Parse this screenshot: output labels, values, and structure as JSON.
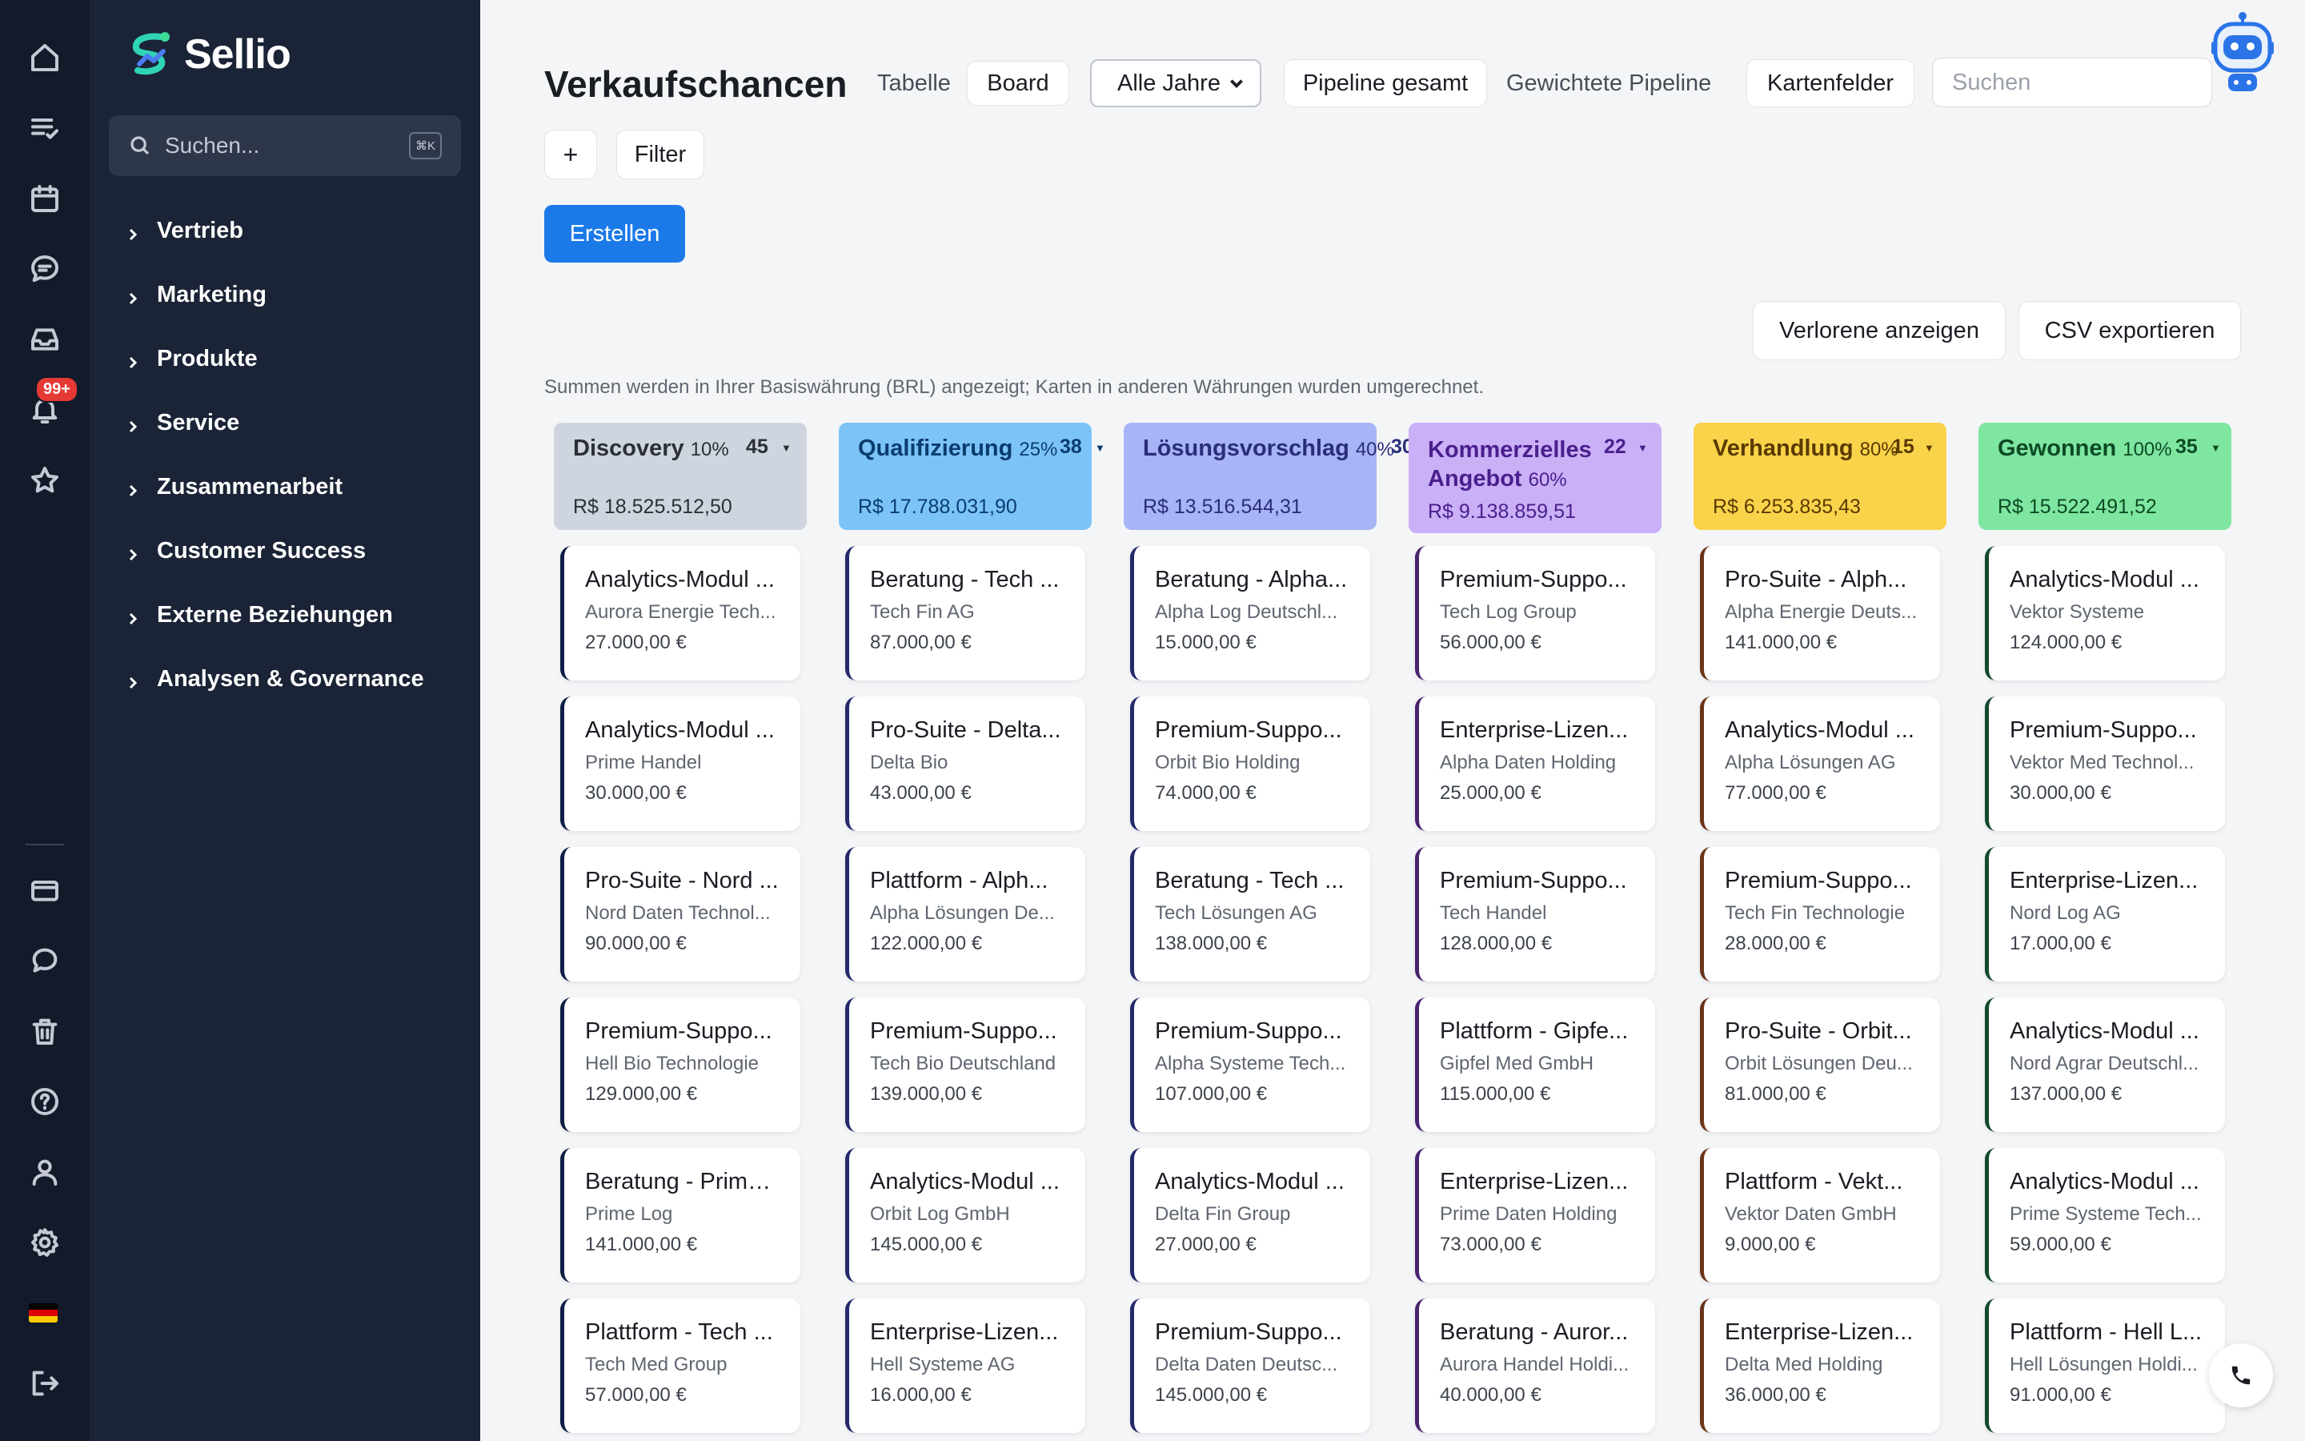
{
  "app": {
    "name": "Sellio"
  },
  "sidebar": {
    "search_placeholder": "Suchen...",
    "search_shortcut": "⌘K",
    "items": [
      {
        "label": "Vertrieb"
      },
      {
        "label": "Marketing"
      },
      {
        "label": "Produkte"
      },
      {
        "label": "Service"
      },
      {
        "label": "Zusammenarbeit"
      },
      {
        "label": "Customer Success"
      },
      {
        "label": "Externe Beziehungen"
      },
      {
        "label": "Analysen & Governance"
      }
    ]
  },
  "rail": {
    "icons": [
      "home-icon",
      "tasks-icon",
      "calendar-icon",
      "chat-icon",
      "inbox-icon",
      "bell-icon",
      "star-icon",
      "card-icon",
      "comment-icon",
      "trash-icon",
      "help-icon",
      "user-icon",
      "settings-icon",
      "flag-de-icon",
      "logout-icon"
    ],
    "notification_badge": "99+"
  },
  "header": {
    "title": "Verkaufschancen",
    "view_tabs": [
      "Tabelle",
      "Board"
    ],
    "active_view": "Board",
    "year_select": "Alle Jahre",
    "pipeline_total": "Pipeline gesamt",
    "pipeline_weighted": "Gewichtete Pipeline",
    "card_fields": "Kartenfelder",
    "search_placeholder": "Suchen",
    "add_label": "+",
    "filter_label": "Filter",
    "create_label": "Erstellen",
    "show_lost": "Verlorene anzeigen",
    "export_csv": "CSV exportieren"
  },
  "info_text": "Summen werden in Ihrer Basiswährung (BRL) angezeigt; Karten in anderen Währungen wurden umgerechnet.",
  "colors": {
    "primary": "#1b7ae8",
    "rail_bg": "#131a2a",
    "sidebar_bg": "#1b2436"
  },
  "columns": [
    {
      "title": "Discovery",
      "pct": "10%",
      "count": "45",
      "sum": "R$ 18.525.512,50",
      "head_color": "#cfd5de",
      "text_color": "#2a2f38",
      "accent": "#0f1e44",
      "cards": [
        {
          "title": "Analytics-Modul ...",
          "company": "Aurora Energie Tech...",
          "amount": "27.000,00 €"
        },
        {
          "title": "Analytics-Modul ...",
          "company": "Prime Handel",
          "amount": "30.000,00 €"
        },
        {
          "title": "Pro-Suite - Nord ...",
          "company": "Nord Daten Technol...",
          "amount": "90.000,00 €"
        },
        {
          "title": "Premium-Suppo...",
          "company": "Hell Bio Technologie",
          "amount": "129.000,00 €"
        },
        {
          "title": "Beratung - Prime...",
          "company": "Prime Log",
          "amount": "141.000,00 €"
        },
        {
          "title": "Plattform - Tech ...",
          "company": "Tech Med Group",
          "amount": "57.000,00 €"
        }
      ]
    },
    {
      "title": "Qualifizierung",
      "pct": "25%",
      "count": "38",
      "sum": "R$ 17.788.031,90",
      "head_color": "#7cc4f8",
      "text_color": "#0b3c6e",
      "accent": "#23296b",
      "cards": [
        {
          "title": "Beratung - Tech ...",
          "company": "Tech Fin AG",
          "amount": "87.000,00 €"
        },
        {
          "title": "Pro-Suite - Delta...",
          "company": "Delta Bio",
          "amount": "43.000,00 €"
        },
        {
          "title": "Plattform - Alph...",
          "company": "Alpha Lösungen De...",
          "amount": "122.000,00 €"
        },
        {
          "title": "Premium-Suppo...",
          "company": "Tech Bio Deutschland",
          "amount": "139.000,00 €"
        },
        {
          "title": "Analytics-Modul ...",
          "company": "Orbit Log GmbH",
          "amount": "145.000,00 €"
        },
        {
          "title": "Enterprise-Lizen...",
          "company": "Hell Systeme AG",
          "amount": "16.000,00 €"
        }
      ]
    },
    {
      "title": "Lösungsvorschlag",
      "pct": "40%",
      "count": "30",
      "sum": "R$ 13.516.544,31",
      "head_color": "#a7b4f6",
      "text_color": "#2a2e7a",
      "accent": "#23296b",
      "cards": [
        {
          "title": "Beratung - Alpha...",
          "company": "Alpha Log Deutschl...",
          "amount": "15.000,00 €"
        },
        {
          "title": "Premium-Suppo...",
          "company": "Orbit Bio Holding",
          "amount": "74.000,00 €"
        },
        {
          "title": "Beratung - Tech ...",
          "company": "Tech Lösungen AG",
          "amount": "138.000,00 €"
        },
        {
          "title": "Premium-Suppo...",
          "company": "Alpha Systeme Tech...",
          "amount": "107.000,00 €"
        },
        {
          "title": "Analytics-Modul ...",
          "company": "Delta Fin Group",
          "amount": "27.000,00 €"
        },
        {
          "title": "Premium-Suppo...",
          "company": "Delta Daten Deutsc...",
          "amount": "145.000,00 €"
        }
      ]
    },
    {
      "title": "Kommerzielles Angebot",
      "title_line1": "Kommerzielles",
      "title_line2": "Angebot",
      "pct": "60%",
      "count": "22",
      "sum": "R$ 9.138.859,51",
      "head_color": "#c9b0f7",
      "text_color": "#4a1f8c",
      "accent": "#4a2370",
      "cards": [
        {
          "title": "Premium-Suppo...",
          "company": "Tech Log Group",
          "amount": "56.000,00 €"
        },
        {
          "title": "Enterprise-Lizen...",
          "company": "Alpha Daten Holding",
          "amount": "25.000,00 €"
        },
        {
          "title": "Premium-Suppo...",
          "company": "Tech Handel",
          "amount": "128.000,00 €"
        },
        {
          "title": "Plattform - Gipfe...",
          "company": "Gipfel Med GmbH",
          "amount": "115.000,00 €"
        },
        {
          "title": "Enterprise-Lizen...",
          "company": "Prime Daten Holding",
          "amount": "73.000,00 €"
        },
        {
          "title": "Beratung - Auror...",
          "company": "Aurora Handel Holdi...",
          "amount": "40.000,00 €"
        }
      ]
    },
    {
      "title": "Verhandlung",
      "pct": "80%",
      "count": "15",
      "sum": "R$ 6.253.835,43",
      "head_color": "#f9d34a",
      "text_color": "#5a3a00",
      "accent": "#6b3518",
      "cards": [
        {
          "title": "Pro-Suite - Alph...",
          "company": "Alpha Energie Deuts...",
          "amount": "141.000,00 €"
        },
        {
          "title": "Analytics-Modul ...",
          "company": "Alpha Lösungen AG",
          "amount": "77.000,00 €"
        },
        {
          "title": "Premium-Suppo...",
          "company": "Tech Fin Technologie",
          "amount": "28.000,00 €"
        },
        {
          "title": "Pro-Suite - Orbit...",
          "company": "Orbit Lösungen Deu...",
          "amount": "81.000,00 €"
        },
        {
          "title": "Plattform - Vekt...",
          "company": "Vektor Daten GmbH",
          "amount": "9.000,00 €"
        },
        {
          "title": "Enterprise-Lizen...",
          "company": "Delta Med Holding",
          "amount": "36.000,00 €"
        }
      ]
    },
    {
      "title": "Gewonnen",
      "pct": "100%",
      "count": "35",
      "sum": "R$ 15.522.491,52",
      "head_color": "#7ee6a0",
      "text_color": "#0d4a25",
      "accent": "#124a2c",
      "cards": [
        {
          "title": "Analytics-Modul ...",
          "company": "Vektor Systeme",
          "amount": "124.000,00 €"
        },
        {
          "title": "Premium-Suppo...",
          "company": "Vektor Med Technol...",
          "amount": "30.000,00 €"
        },
        {
          "title": "Enterprise-Lizen...",
          "company": "Nord Log AG",
          "amount": "17.000,00 €"
        },
        {
          "title": "Analytics-Modul ...",
          "company": "Nord Agrar Deutschl...",
          "amount": "137.000,00 €"
        },
        {
          "title": "Analytics-Modul ...",
          "company": "Prime Systeme Tech...",
          "amount": "59.000,00 €"
        },
        {
          "title": "Plattform - Hell L...",
          "company": "Hell Lösungen Holdi...",
          "amount": "91.000,00 €"
        }
      ]
    }
  ]
}
